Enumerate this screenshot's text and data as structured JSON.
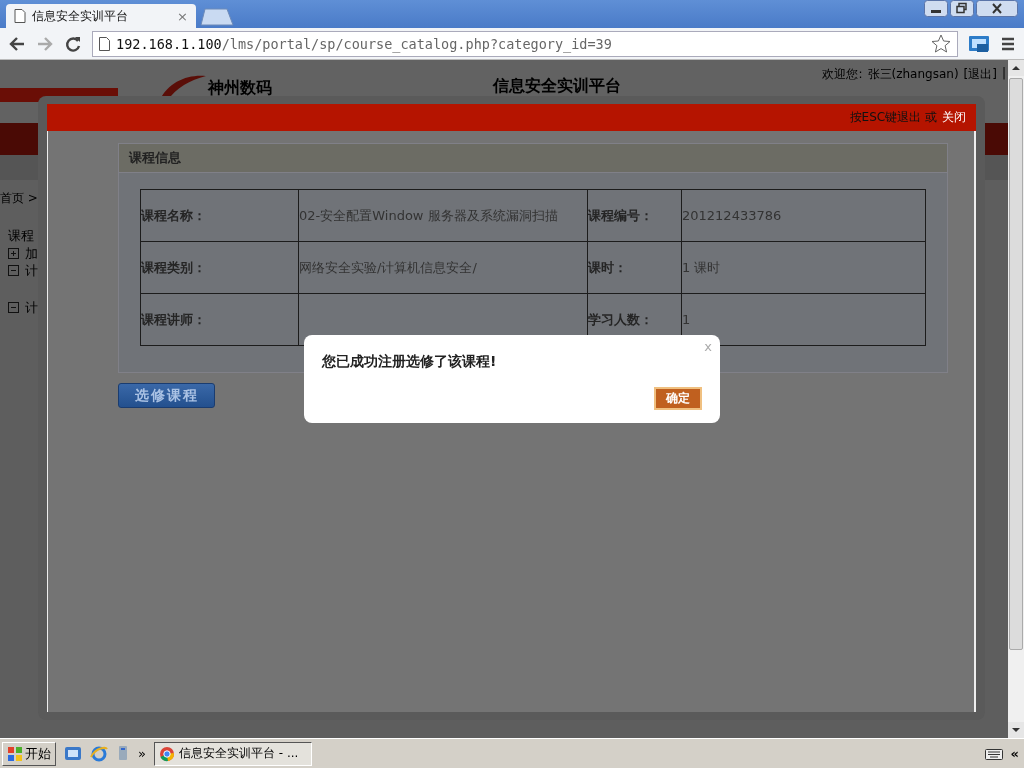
{
  "browser": {
    "tab": {
      "title": "信息安全实训平台",
      "close": "×"
    },
    "url": {
      "host": "192.168.1.100",
      "path": "/lms/portal/sp/course_catalog.php?category_id=39"
    }
  },
  "page": {
    "brand": "神州数码",
    "site_title": "信息安全实训平台",
    "welcome": "欢迎您:",
    "user": "张三(zhangsan)",
    "logout": "[退出]",
    "separator": "|",
    "breadcrumb": "首页 >",
    "tree_title": "课程",
    "tree": [
      {
        "label": "加",
        "expanded": false
      },
      {
        "label": "计",
        "expanded": true
      },
      {
        "label": "计",
        "expanded": true
      }
    ]
  },
  "lightbox": {
    "hint": "按ESC键退出 或",
    "close": "关闭",
    "panel_title": "课程信息",
    "rows": [
      [
        {
          "label": "课程名称：",
          "value": "02-安全配置Window 服务器及系统漏洞扫描"
        },
        {
          "label": "课程编号：",
          "value": "201212433786"
        }
      ],
      [
        {
          "label": "课程类别：",
          "value": "网络安全实验/计算机信息安全/"
        },
        {
          "label": "课时：",
          "value": "1 课时"
        }
      ],
      [
        {
          "label": "课程讲师："
        },
        {
          "label": "学习人数：",
          "value": "1"
        }
      ]
    ],
    "enroll_button": "选修课程"
  },
  "dialog": {
    "close": "x",
    "message": "您已成功注册选修了该课程!",
    "ok": "确定"
  },
  "taskbar": {
    "start": "开始",
    "more": "»",
    "window": "信息安全实训平台 - ...",
    "tray_arrow": "«"
  }
}
